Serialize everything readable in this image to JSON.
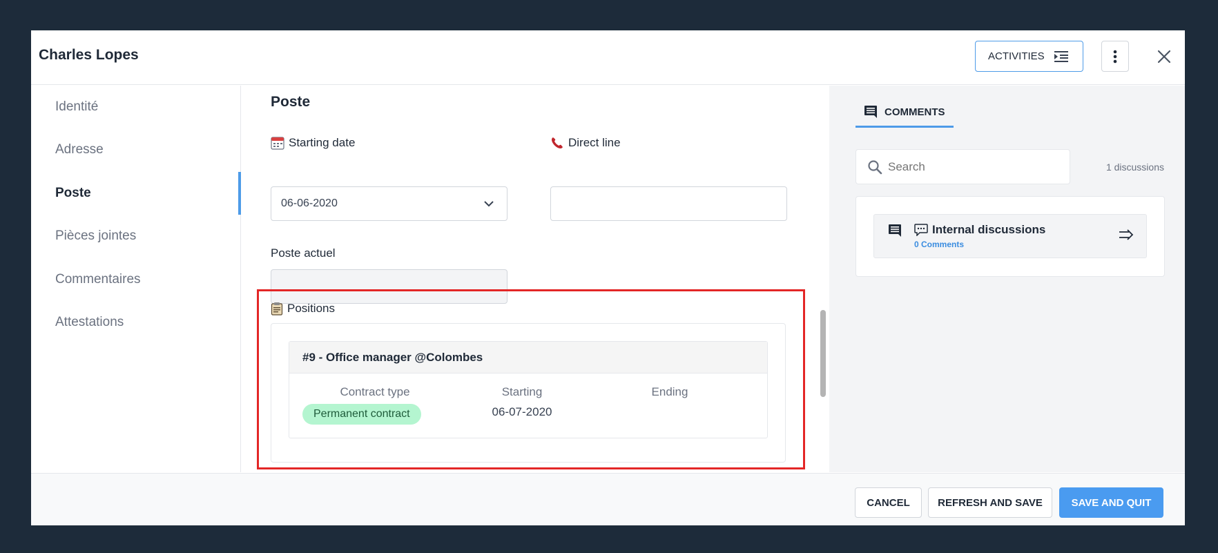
{
  "header": {
    "title": "Charles Lopes",
    "activities_label": "ACTIVITIES"
  },
  "sidebar": {
    "items": [
      {
        "label": "Identité"
      },
      {
        "label": "Adresse"
      },
      {
        "label": "Poste"
      },
      {
        "label": "Pièces jointes"
      },
      {
        "label": "Commentaires"
      },
      {
        "label": "Attestations"
      }
    ],
    "active": "Poste"
  },
  "form": {
    "section_title": "Poste",
    "starting_date": {
      "label": "Starting date",
      "value": "06-06-2020"
    },
    "direct_line": {
      "label": "Direct line",
      "value": ""
    },
    "poste_actuel": {
      "label": "Poste actuel",
      "value": ""
    },
    "positions": {
      "label": "Positions",
      "items": [
        {
          "title": "#9 - Office manager @Colombes",
          "contract_type_label": "Contract type",
          "starting_label": "Starting",
          "ending_label": "Ending",
          "contract_type": "Permanent contract",
          "starting": "06-07-2020",
          "ending": ""
        }
      ]
    }
  },
  "comments": {
    "tab_label": "COMMENTS",
    "search_placeholder": "Search",
    "discussions_count": "1 discussions",
    "discussions": [
      {
        "title": "Internal discussions",
        "subtitle": "0 Comments"
      }
    ]
  },
  "footer": {
    "cancel_label": "CANCEL",
    "refresh_label": "REFRESH AND SAVE",
    "save_label": "SAVE AND QUIT"
  },
  "colors": {
    "accent": "#4a9bf0",
    "highlight": "#e32626",
    "badge": "#b4f5d0",
    "backdrop": "#1d2b3a"
  }
}
